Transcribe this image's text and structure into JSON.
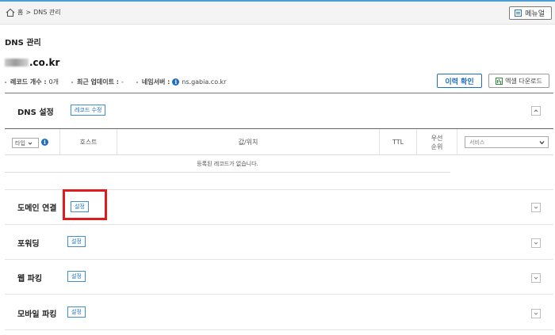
{
  "breadcrumb": {
    "home": "홈",
    "separator": ">",
    "current": "DNS 관리"
  },
  "menu_button": {
    "label": "메뉴얼"
  },
  "page_title": "DNS 관리",
  "domain": {
    "suffix": ".co.kr"
  },
  "info": {
    "record_count_label": "레코드 개수 :",
    "record_count_value": "0개",
    "last_update_label": "최근 업데이트 :",
    "last_update_value": "-",
    "nameserver_label": "네임서버 :",
    "nameserver_value": "ns.gabia.co.kr"
  },
  "buttons": {
    "history": "이력 확인",
    "excel": "엑셀 다운로드"
  },
  "dns_section": {
    "title": "DNS 설정",
    "edit_button": "레코드 수정"
  },
  "table": {
    "type_select": "타입",
    "columns": [
      "호스트",
      "값/위치",
      "TTL",
      "우선",
      "순위"
    ],
    "service_select": "서비스",
    "empty_message": "등록된 레코드가 없습니다."
  },
  "sections": [
    {
      "title": "도메인 연결",
      "button": "설정"
    },
    {
      "title": "포워딩",
      "button": "설정"
    },
    {
      "title": "웹 파킹",
      "button": "설정"
    },
    {
      "title": "모바일 파킹",
      "button": "설정"
    }
  ],
  "colors": {
    "accent": "#1e6fc0",
    "highlight": "#e01b1b",
    "topline": "#4a9fd8"
  }
}
